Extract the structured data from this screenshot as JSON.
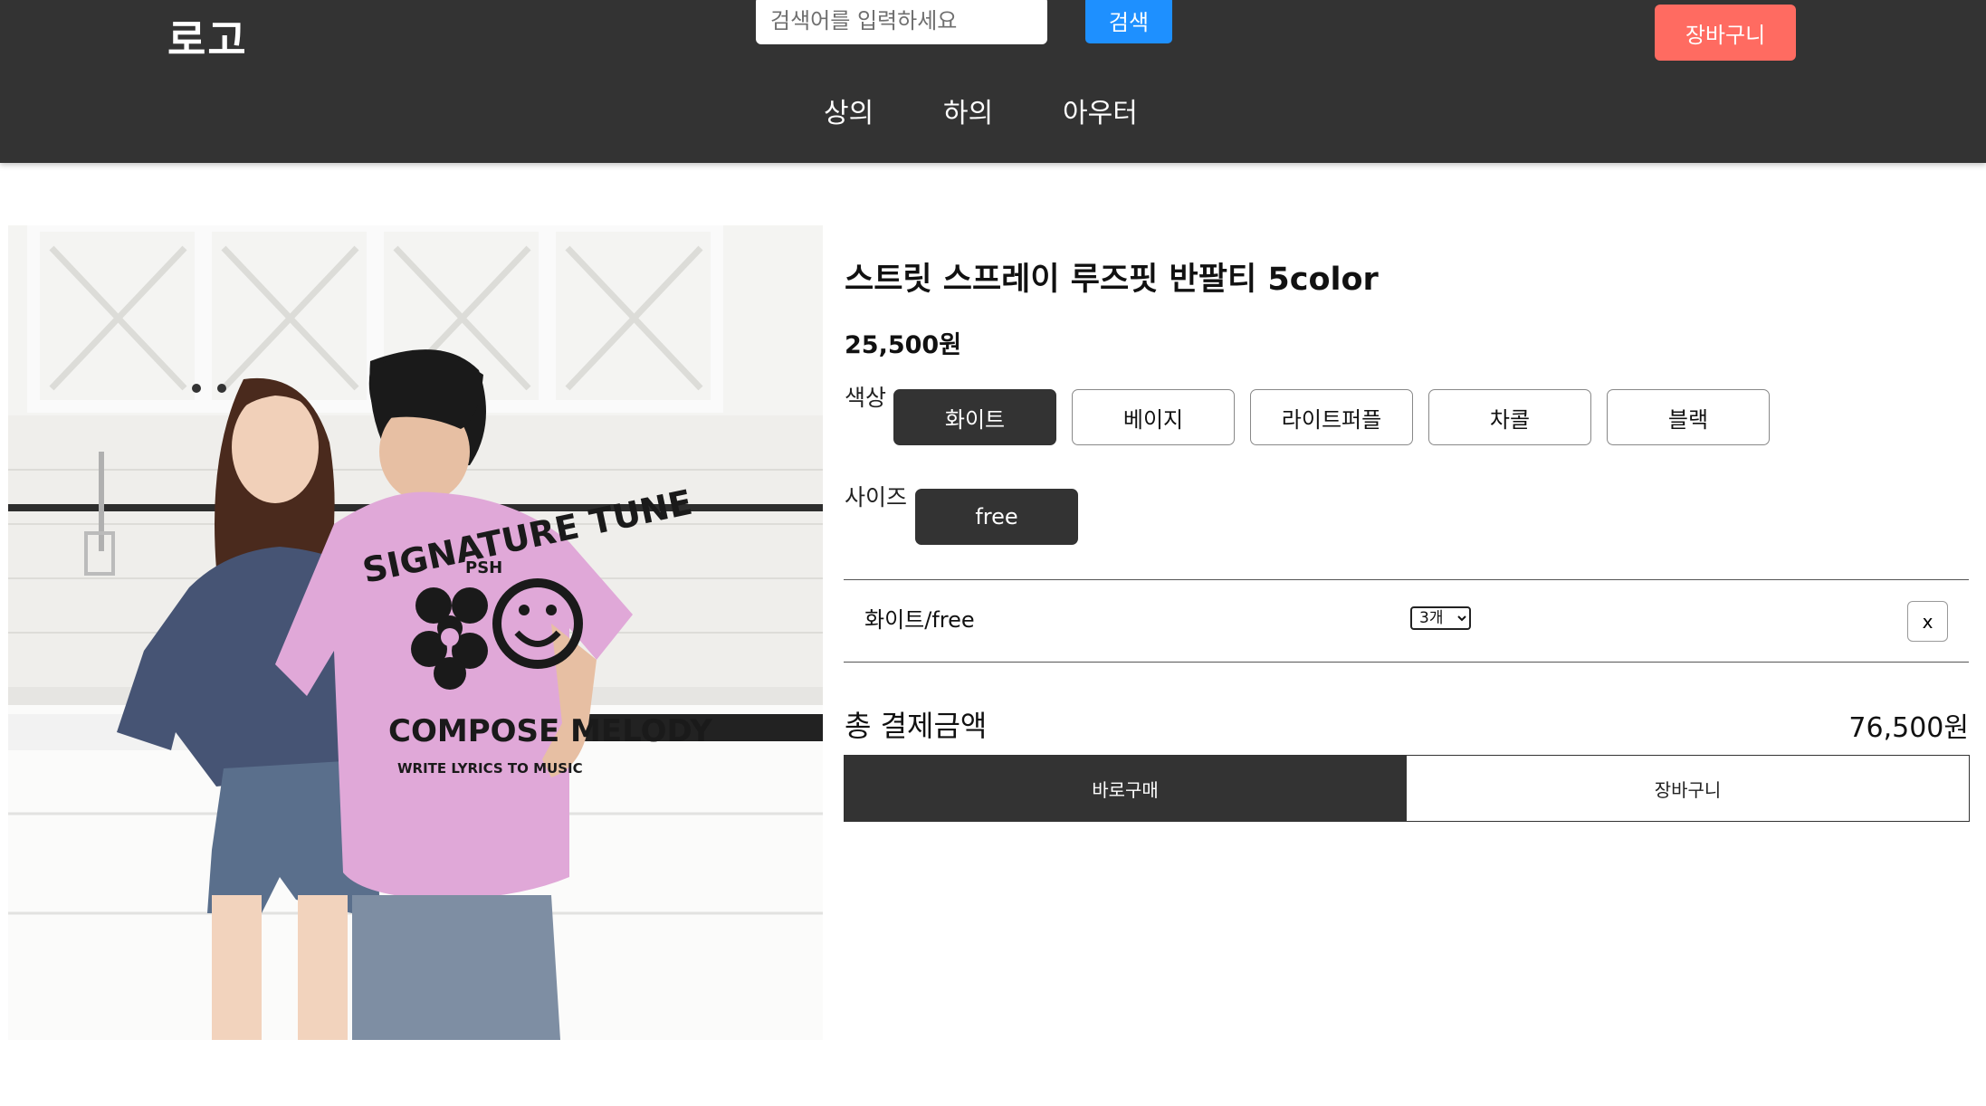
{
  "header": {
    "logo": "로고",
    "search": {
      "placeholder": "검색어를 입력하세요",
      "button_label": "검색"
    },
    "cart_label": "장바구니",
    "nav": [
      "상의",
      "하의",
      "아우터"
    ]
  },
  "product": {
    "title": "스트릿 스프레이 루즈핏 반팔티 5color",
    "price": "25,500원",
    "image_print": {
      "line1": "SIGNATURE TUNE",
      "line2": "PSH",
      "line3": "COMPOSE MELODY",
      "line4": "WRITE LYRICS TO MUSIC"
    },
    "color_label": "색상",
    "colors": [
      "화이트",
      "베이지",
      "라이트퍼플",
      "차콜",
      "블랙"
    ],
    "selected_color": "화이트",
    "size_label": "사이즈",
    "sizes": [
      "free"
    ],
    "selected_size": "free"
  },
  "selection": {
    "text": "화이트/free",
    "quantity": "3개",
    "remove_label": "x"
  },
  "total": {
    "label": "총 결제금액",
    "value": "76,500원"
  },
  "actions": {
    "buy_label": "바로구매",
    "cart_label": "장바구니"
  },
  "colors": {
    "header_bg": "#333333",
    "search_button": "#1e90ff",
    "cart_button": "#ff6b61",
    "selected_option": "#333333"
  }
}
